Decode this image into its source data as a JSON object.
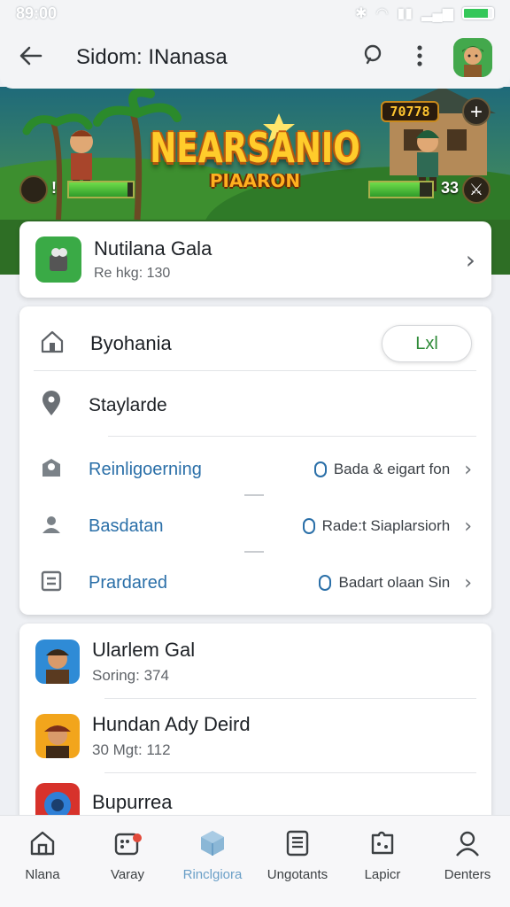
{
  "status_bar": {
    "time": "89:00",
    "icons": [
      "bluetooth-icon",
      "wifi-icon",
      "signal-icon",
      "battery-icon"
    ]
  },
  "app_bar": {
    "title": "Sidom: INanasa"
  },
  "banner": {
    "title": "NEARSANIO",
    "subtitle": "PIAARON",
    "score": "70778",
    "level": "33",
    "health_fill": 0.92,
    "energy_fill": 0.8
  },
  "featured": {
    "title": "Nutilana Gala",
    "subtitle": "Re hkg: 130"
  },
  "settings": {
    "header_label": "Byohania",
    "header_button": "Lxl",
    "subheader": "Staylarde",
    "items": [
      {
        "label": "Reinligoerning",
        "detail": "Bada & eigart fon"
      },
      {
        "label": "Basdatan",
        "detail": "Rade:t Siaplarsiorh"
      },
      {
        "label": "Prardared",
        "detail": "Badart olaan Sin"
      }
    ]
  },
  "games": [
    {
      "title": "Ularlem Gal",
      "subtitle": "Soring: 374"
    },
    {
      "title": "Hundan Ady Deird",
      "subtitle": "30 Mgt: 112"
    },
    {
      "title": "Bupurrea",
      "subtitle": ""
    }
  ],
  "nav": [
    {
      "label": "Nlana",
      "icon": "home-icon"
    },
    {
      "label": "Varay",
      "icon": "game-controller-icon"
    },
    {
      "label": "Rinclgiora",
      "icon": "cube-icon"
    },
    {
      "label": "Ungotants",
      "icon": "document-icon"
    },
    {
      "label": "Lapicr",
      "icon": "puzzle-icon"
    },
    {
      "label": "Denters",
      "icon": "person-icon"
    }
  ],
  "colors": {
    "accent_green": "#2f8b39",
    "link_blue": "#2a6fa8",
    "active_nav": "#6a9fc7"
  }
}
